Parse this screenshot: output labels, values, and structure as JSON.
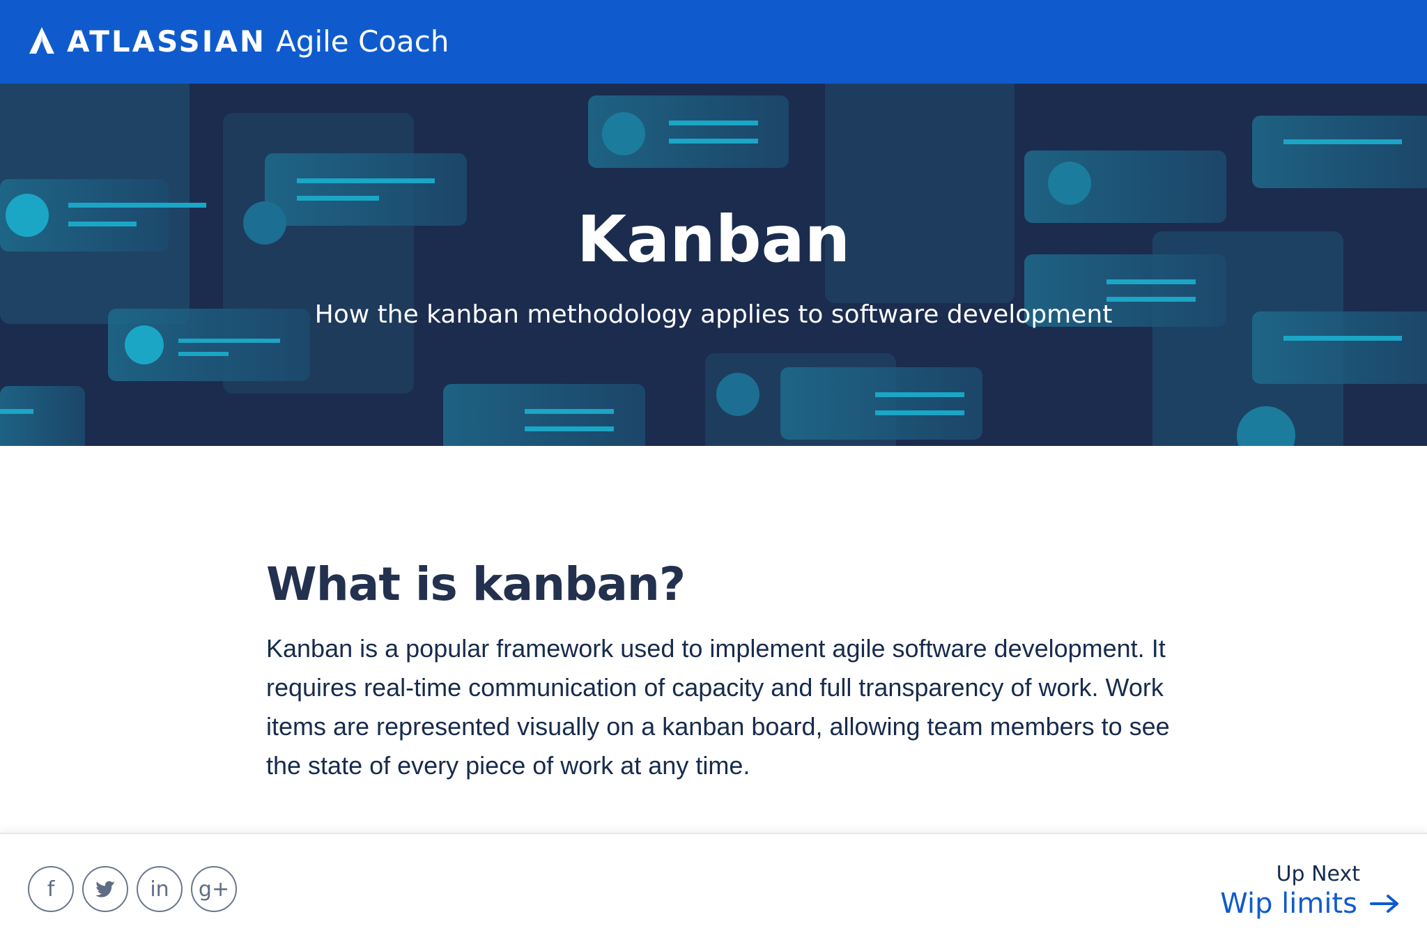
{
  "header": {
    "brand_name": "ATLASSIAN",
    "product_name": "Agile Coach",
    "logo_icon": "atlassian-logo-icon",
    "background_color": "#0f5bcd"
  },
  "hero": {
    "title": "Kanban",
    "subtitle": "How the kanban methodology applies to software development",
    "background_color": "#1b2c4e",
    "accent_color": "#1ba6c6"
  },
  "main": {
    "heading": "What is kanban?",
    "body": "Kanban is a popular framework used to implement agile software development. It requires real-time communication of capacity and full transparency of work. Work items are represented visually on a kanban board, allowing team members to see the state of every piece of work at any time."
  },
  "footer": {
    "social": [
      {
        "icon": "facebook-icon",
        "glyph": "f"
      },
      {
        "icon": "twitter-icon",
        "glyph": ""
      },
      {
        "icon": "linkedin-icon",
        "glyph": "in"
      },
      {
        "icon": "google-plus-icon",
        "glyph": "g+"
      }
    ],
    "up_next_label": "Up Next",
    "up_next_link": "Wip limits",
    "link_color": "#0f5bcd"
  }
}
